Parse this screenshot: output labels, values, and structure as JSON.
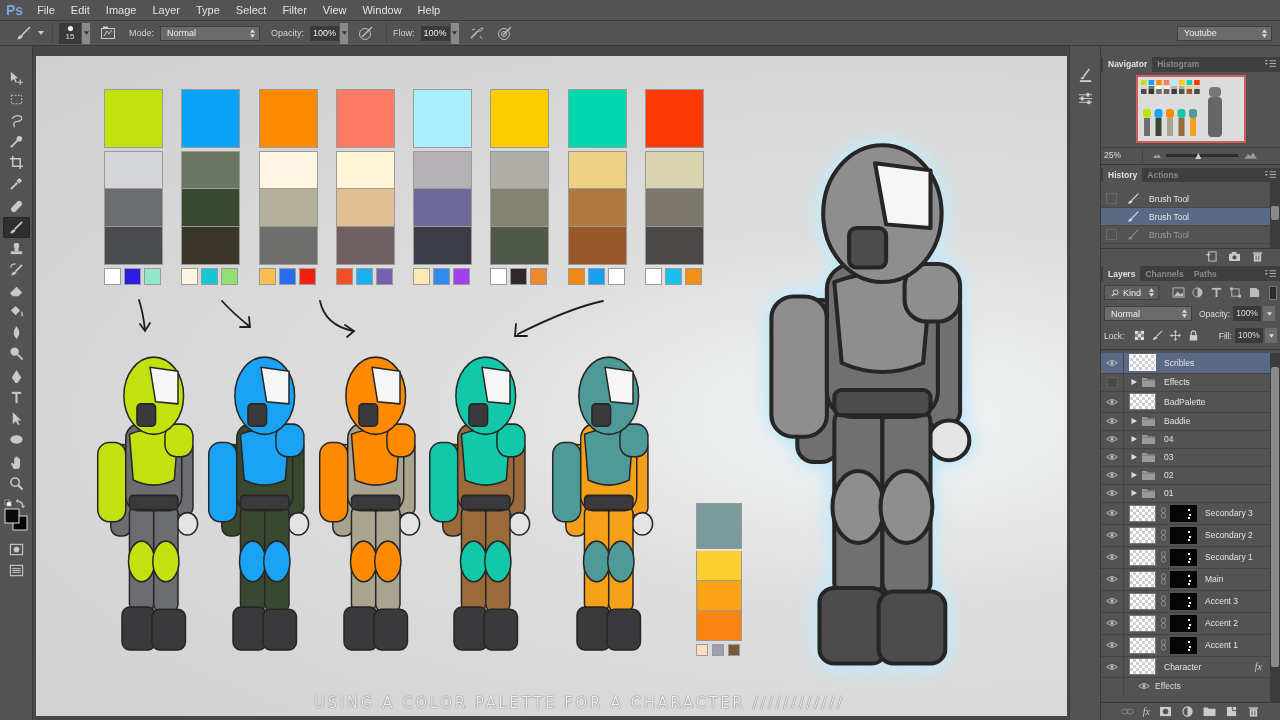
{
  "menu_bar": {
    "logo": "Ps",
    "items": [
      "File",
      "Edit",
      "Image",
      "Layer",
      "Type",
      "Select",
      "Filter",
      "View",
      "Window",
      "Help"
    ]
  },
  "options_bar": {
    "brush_size": "15",
    "mode_label": "Mode:",
    "mode": "Normal",
    "opacity_label": "Opacity:",
    "opacity": "100%",
    "flow_label": "Flow:",
    "flow": "100%",
    "workspace": "Youtube"
  },
  "tools": [
    {
      "kind": "move",
      "selected": false
    },
    {
      "kind": "marquee",
      "selected": false
    },
    {
      "kind": "lasso",
      "selected": false
    },
    {
      "kind": "wand",
      "selected": false
    },
    {
      "kind": "crop",
      "selected": false
    },
    {
      "kind": "eyedropper",
      "selected": false
    },
    {
      "kind": "healing",
      "selected": false
    },
    {
      "kind": "brush",
      "selected": true
    },
    {
      "kind": "stamp",
      "selected": false
    },
    {
      "kind": "history-brush",
      "selected": false
    },
    {
      "kind": "eraser",
      "selected": false
    },
    {
      "kind": "bucket",
      "selected": false
    },
    {
      "kind": "blur",
      "selected": false
    },
    {
      "kind": "dodge",
      "selected": false
    },
    {
      "kind": "pen",
      "selected": false
    },
    {
      "kind": "type",
      "selected": false
    },
    {
      "kind": "select",
      "selected": false
    },
    {
      "kind": "ellipse",
      "selected": false
    },
    {
      "kind": "hand",
      "selected": false
    },
    {
      "kind": "zoom",
      "selected": false
    },
    {
      "kind": "mask",
      "selected": false
    },
    {
      "kind": "screen",
      "selected": false
    }
  ],
  "canvas": {
    "palettes": [
      {
        "main": {
          "color": "#c3e10e"
        },
        "shades": [
          {
            "color": "#d5d6da"
          },
          {
            "color": "#6c6d71"
          },
          {
            "color": "#4a4b4f"
          }
        ],
        "accents": [
          {
            "color": "#ffffff"
          },
          {
            "color": "#2a1fe0"
          },
          {
            "color": "#8fe8cc"
          }
        ]
      },
      {
        "main": {
          "color": "#0aa3fb"
        },
        "shades": [
          {
            "color": "#6b7762"
          },
          {
            "color": "#3b4830"
          },
          {
            "color": "#3a3728"
          }
        ],
        "accents": [
          {
            "color": "#fdf5df"
          },
          {
            "color": "#14c8d8"
          },
          {
            "color": "#90e070"
          }
        ]
      },
      {
        "main": {
          "color": "#fd8a00"
        },
        "shades": [
          {
            "color": "#fff5e0"
          },
          {
            "color": "#b4b09a"
          },
          {
            "color": "#6e6e6c"
          }
        ],
        "accents": [
          {
            "color": "#f8c050"
          },
          {
            "color": "#2a6cf0"
          },
          {
            "color": "#f02010"
          }
        ]
      },
      {
        "main": {
          "color": "#fd7b65"
        },
        "shades": [
          {
            "color": "#fff4d6"
          },
          {
            "color": "#e0c090"
          },
          {
            "color": "#705f61"
          }
        ],
        "accents": [
          {
            "color": "#f05028"
          },
          {
            "color": "#18b0f0"
          },
          {
            "color": "#7860b0"
          }
        ]
      },
      {
        "main": {
          "color": "#aaeeff"
        },
        "shades": [
          {
            "color": "#b4b2b6"
          },
          {
            "color": "#706a98"
          },
          {
            "color": "#3c3c48"
          }
        ],
        "accents": [
          {
            "color": "#fce8b0"
          },
          {
            "color": "#2c8cf0"
          },
          {
            "color": "#a040f0"
          }
        ]
      },
      {
        "main": {
          "color": "#ffcc00"
        },
        "shades": [
          {
            "color": "#b0aea8"
          },
          {
            "color": "#848270"
          },
          {
            "color": "#505848"
          }
        ],
        "accents": [
          {
            "color": "#ffffff"
          },
          {
            "color": "#302828"
          },
          {
            "color": "#f08830"
          }
        ]
      },
      {
        "main": {
          "color": "#00d8b0"
        },
        "shades": [
          {
            "color": "#ecd084"
          },
          {
            "color": "#b0783c"
          },
          {
            "color": "#98582c"
          }
        ],
        "accents": [
          {
            "color": "#f08818"
          },
          {
            "color": "#18a0f0"
          },
          {
            "color": "#ffffff"
          }
        ]
      },
      {
        "main": {
          "color": "#ff3a05"
        },
        "shades": [
          {
            "color": "#d8d4b0"
          },
          {
            "color": "#7c786c"
          },
          {
            "color": "#4c4848"
          }
        ],
        "accents": [
          {
            "color": "#ffffff"
          },
          {
            "color": "#18c0f0"
          },
          {
            "color": "#f09018"
          }
        ]
      }
    ],
    "characters": [
      {
        "color": "#c3e10e",
        "body": {
          "color": "#6c6d71"
        }
      },
      {
        "color": "#1aa3f5",
        "body": {
          "color": "#3b4830"
        }
      },
      {
        "color": "#fd8a00",
        "body": {
          "color": "#a8a490"
        }
      },
      {
        "color": "#12c8a8",
        "body": {
          "color": "#9a6a3a"
        }
      },
      {
        "color": "#4e9a98",
        "body": {
          "color": "#f6a019"
        }
      }
    ],
    "side_palette": {
      "shades": [
        {
          "color": "#7a9a9b"
        },
        {
          "color": "#fcd12f"
        },
        {
          "color": "#fca414"
        },
        {
          "color": "#fb8412"
        }
      ],
      "accents": [
        {
          "color": "#f7dfc0"
        },
        {
          "color": "#9ea0b0"
        },
        {
          "color": "#7a5a3a"
        }
      ]
    },
    "caption": "USING A COLOR PALETTE FOR A CHARACTER ////////////"
  },
  "navigator": {
    "tabs": [
      {
        "label": "Navigator",
        "selected": true
      },
      {
        "label": "Histogram",
        "selected": false
      }
    ],
    "zoom": "25%",
    "zoom_slider": {
      "level": 0.45
    }
  },
  "history": {
    "tabs": [
      {
        "label": "History",
        "selected": true
      },
      {
        "label": "Actions",
        "selected": false
      }
    ],
    "items": [
      {
        "label": "Brush Tool",
        "selected": false,
        "disabled": false
      },
      {
        "label": "Brush Tool",
        "selected": true,
        "disabled": false
      },
      {
        "label": "Brush Tool",
        "selected": false,
        "disabled": true
      }
    ]
  },
  "layers": {
    "tabs": [
      {
        "label": "Layers",
        "selected": true
      },
      {
        "label": "Channels",
        "selected": false
      },
      {
        "label": "Paths",
        "selected": false
      }
    ],
    "filter": "Kind",
    "blend_mode": "Normal",
    "opacity_label": "Opacity:",
    "opacity": "100%",
    "lock_label": "Lock:",
    "fill_label": "Fill:",
    "fill": "100%",
    "items": [
      {
        "name": "Scribles",
        "kind": "layer",
        "visible": true,
        "selected": true
      },
      {
        "name": "Effects",
        "kind": "group",
        "visible": false,
        "selected": false,
        "expanded": false
      },
      {
        "name": "BadPalette",
        "kind": "layer",
        "visible": true,
        "selected": false
      },
      {
        "name": "Baddie",
        "kind": "group",
        "visible": true,
        "selected": false,
        "expanded": false
      },
      {
        "name": "04",
        "kind": "group",
        "visible": true,
        "selected": false,
        "expanded": false
      },
      {
        "name": "03",
        "kind": "group",
        "visible": true,
        "selected": false,
        "expanded": false
      },
      {
        "name": "02",
        "kind": "group",
        "visible": true,
        "selected": false,
        "expanded": false
      },
      {
        "name": "01",
        "kind": "group",
        "visible": true,
        "selected": false,
        "expanded": false
      },
      {
        "name": "Secondary 3",
        "kind": "masked",
        "visible": true,
        "selected": false
      },
      {
        "name": "Secondary 2",
        "kind": "masked",
        "visible": true,
        "selected": false
      },
      {
        "name": "Secondary 1",
        "kind": "masked",
        "visible": true,
        "selected": false
      },
      {
        "name": "Main",
        "kind": "masked",
        "visible": true,
        "selected": false
      },
      {
        "name": "Accent 3",
        "kind": "masked",
        "visible": true,
        "selected": false
      },
      {
        "name": "Accent 2",
        "kind": "masked",
        "visible": true,
        "selected": false
      },
      {
        "name": "Accent 1",
        "kind": "masked",
        "visible": true,
        "selected": false
      },
      {
        "name": "Character",
        "kind": "layer",
        "visible": true,
        "selected": false,
        "badge": "fx",
        "children": [
          {
            "name": "Effects",
            "visible": true,
            "selected": false
          }
        ]
      }
    ],
    "fx_button": "fx"
  }
}
